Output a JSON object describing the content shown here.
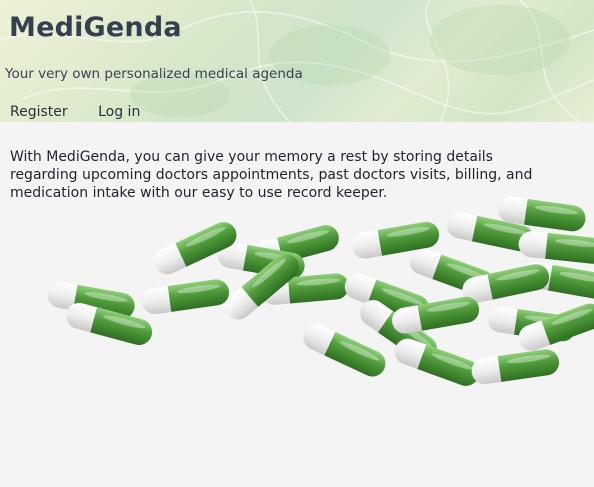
{
  "header": {
    "title": "MediGenda",
    "tagline": "Your very own personalized medical agenda"
  },
  "nav": {
    "register_label": "Register",
    "login_label": "Log in"
  },
  "main": {
    "intro_lines": [
      "With MediGenda, you can give your memory a rest by storing details",
      "regarding upcoming doctors appointments, past doctors visits, billing, and",
      "medication intake with our easy to use record keeper."
    ]
  },
  "hero_image": {
    "subject": "pills-image"
  },
  "colors": {
    "capsule_green": "#4f9a3a",
    "capsule_white": "#f2f2f2",
    "title_color": "#34404f"
  }
}
